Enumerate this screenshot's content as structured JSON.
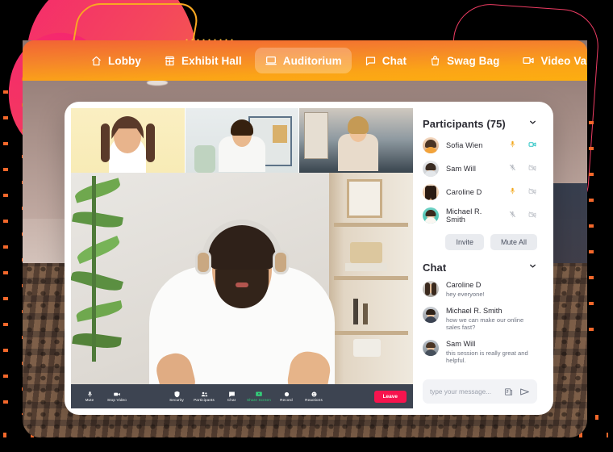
{
  "nav": {
    "items": [
      {
        "label": "Lobby",
        "icon": "home-icon",
        "active": false
      },
      {
        "label": "Exhibit Hall",
        "icon": "store-icon",
        "active": false
      },
      {
        "label": "Auditorium",
        "icon": "laptop-icon",
        "active": true
      },
      {
        "label": "Chat",
        "icon": "chat-bubble-icon",
        "active": false
      },
      {
        "label": "Swag Bag",
        "icon": "bag-icon",
        "active": false
      },
      {
        "label": "Video Vault",
        "icon": "video-camera-icon",
        "active": false
      }
    ]
  },
  "participants": {
    "title": "Participants (75)",
    "count": 75,
    "rows": [
      {
        "name": "Sofia Wien",
        "mic": "on",
        "cam": "on"
      },
      {
        "name": "Sam Will",
        "mic": "off",
        "cam": "off"
      },
      {
        "name": "Caroline D",
        "mic": "on",
        "cam": "off"
      },
      {
        "name": "Michael R. Smith",
        "mic": "off",
        "cam": "off"
      }
    ],
    "invite_label": "Invite",
    "mute_all_label": "Mute All"
  },
  "chat": {
    "title": "Chat",
    "messages": [
      {
        "name": "Caroline D",
        "text": "hey everyone!"
      },
      {
        "name": "Michael R. Smith",
        "text": "how we can make our online sales fast?"
      },
      {
        "name": "Sam Will",
        "text": "this session is really great and helpful."
      }
    ],
    "input_placeholder": "type your message...",
    "attach_icon": "attachment-icon",
    "send_icon": "send-icon"
  },
  "toolbar": {
    "buttons": [
      {
        "label": "Mute",
        "icon": "microphone-icon",
        "highlight": false
      },
      {
        "label": "Stop Video",
        "icon": "video-camera-icon",
        "highlight": false
      },
      {
        "label": "Security",
        "icon": "shield-icon",
        "highlight": false
      },
      {
        "label": "Participants",
        "icon": "people-icon",
        "highlight": false
      },
      {
        "label": "Chat",
        "icon": "chat-bubble-icon",
        "highlight": false
      },
      {
        "label": "Share Screen",
        "icon": "share-screen-icon",
        "highlight": true
      },
      {
        "label": "Record",
        "icon": "record-icon",
        "highlight": false
      },
      {
        "label": "Reactions",
        "icon": "reactions-icon",
        "highlight": false
      }
    ],
    "leave_label": "Leave"
  },
  "colors": {
    "nav_gradient_start": "#F26335",
    "nav_gradient_end": "#FDAE10",
    "leave_button": "#F7144E",
    "share_screen": "#33D17A",
    "mic_active": "#F2A81D",
    "cam_active": "#2BC4C4",
    "icon_muted": "#C4C7CD",
    "deco_pink": "#F5286E",
    "deco_yellow": "#F9A822",
    "deco_orange_dot": "#F4682B"
  }
}
